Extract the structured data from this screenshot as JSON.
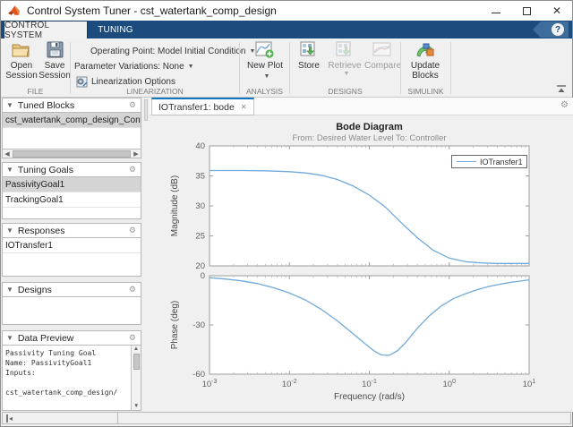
{
  "window": {
    "title": "Control System Tuner - cst_watertank_comp_design",
    "minimize": "–",
    "maximize": "",
    "close": "✕"
  },
  "ribbon_tabs": {
    "control_system": "CONTROL SYSTEM",
    "tuning": "TUNING",
    "help": "?"
  },
  "ribbon": {
    "file": {
      "label": "FILE",
      "open": "Open Session",
      "save": "Save Session"
    },
    "linearization": {
      "label": "LINEARIZATION",
      "operating_point_label": "Operating Point:",
      "operating_point_value": "Model Initial Condition",
      "parameter_variations_label": "Parameter Variations:",
      "parameter_variations_value": "None",
      "options": "Linearization Options"
    },
    "analysis": {
      "label": "ANALYSIS",
      "new_plot": "New Plot"
    },
    "designs": {
      "label": "DESIGNS",
      "store": "Store",
      "retrieve": "Retrieve",
      "compare": "Compare"
    },
    "simulink": {
      "label": "SIMULINK",
      "update_blocks": "Update Blocks"
    }
  },
  "sidebar": {
    "panels": [
      {
        "title": "Tuned Blocks",
        "items": [
          "cst_watertank_comp_design_Controller"
        ],
        "selected": 0
      },
      {
        "title": "Tuning Goals",
        "items": [
          "PassivityGoal1",
          "TrackingGoal1"
        ],
        "selected": 0
      },
      {
        "title": "Responses",
        "items": [
          "IOTransfer1"
        ],
        "selected": -1
      },
      {
        "title": "Designs",
        "items": [],
        "selected": -1
      },
      {
        "title": "Data Preview",
        "items": [],
        "selected": -1
      }
    ],
    "data_preview_lines": [
      "Passivity Tuning Goal",
      "Name: PassivityGoal1",
      "Inputs:",
      "",
      "cst_watertank_comp_design/"
    ]
  },
  "document": {
    "tab": "IOTransfer1: bode",
    "close": "✕"
  },
  "chart_data": {
    "type": "line",
    "title": "Bode Diagram",
    "subtitle": "From: Desired  Water Level  To: Controller",
    "xlabel": "Frequency  (rad/s)",
    "xscale": "log",
    "xlim_exponents": [
      -3,
      1
    ],
    "x_tick_exponents": [
      -3,
      -2,
      -1,
      0,
      1
    ],
    "grid": false,
    "legend": [
      "IOTransfer1"
    ],
    "legend_position": "northeast",
    "line_color": "#72a9dc",
    "subplots": [
      {
        "name": "magnitude",
        "ylabel": "Magnitude (dB)",
        "ylim": [
          20,
          40
        ],
        "yticks": [
          40,
          35,
          30,
          25,
          20
        ],
        "series": [
          {
            "name": "IOTransfer1",
            "points": [
              [
                -3,
                35.9
              ],
              [
                -2.6,
                35.9
              ],
              [
                -2.3,
                35.85
              ],
              [
                -2.0,
                35.7
              ],
              [
                -1.8,
                35.5
              ],
              [
                -1.6,
                35.1
              ],
              [
                -1.4,
                34.4
              ],
              [
                -1.2,
                33.3
              ],
              [
                -1.0,
                31.8
              ],
              [
                -0.8,
                29.8
              ],
              [
                -0.6,
                27.2
              ],
              [
                -0.4,
                24.7
              ],
              [
                -0.2,
                22.6
              ],
              [
                0,
                21.3
              ],
              [
                0.2,
                20.7
              ],
              [
                0.4,
                20.5
              ],
              [
                0.6,
                20.4
              ],
              [
                0.8,
                20.4
              ],
              [
                1,
                20.4
              ]
            ]
          }
        ]
      },
      {
        "name": "phase",
        "ylabel": "Phase (deg)",
        "ylim": [
          -60,
          0
        ],
        "yticks": [
          0,
          -30,
          -60
        ],
        "series": [
          {
            "name": "IOTransfer1",
            "points": [
              [
                -3,
                -1.2
              ],
              [
                -2.8,
                -2
              ],
              [
                -2.6,
                -3.1
              ],
              [
                -2.4,
                -4.8
              ],
              [
                -2.2,
                -7.3
              ],
              [
                -2,
                -10.5
              ],
              [
                -1.8,
                -14.8
              ],
              [
                -1.6,
                -20.5
              ],
              [
                -1.4,
                -27.5
              ],
              [
                -1.2,
                -35.5
              ],
              [
                -1.05,
                -41.5
              ],
              [
                -0.95,
                -45.5
              ],
              [
                -0.85,
                -48.3
              ],
              [
                -0.75,
                -48.5
              ],
              [
                -0.65,
                -45.8
              ],
              [
                -0.55,
                -41
              ],
              [
                -0.4,
                -32
              ],
              [
                -0.25,
                -24.5
              ],
              [
                -0.1,
                -18.5
              ],
              [
                0.05,
                -14
              ],
              [
                0.2,
                -11
              ],
              [
                0.35,
                -8.5
              ],
              [
                0.5,
                -6.5
              ],
              [
                0.65,
                -5
              ],
              [
                0.8,
                -3.8
              ],
              [
                1,
                -2.5
              ]
            ]
          }
        ]
      }
    ]
  },
  "status": {
    "collapse": "◂"
  },
  "colors": {
    "accent_navy": "#1b4c7d",
    "tab_active_border": "#1377bf",
    "curve": "#72a9dc",
    "selection_gray": "#d4d4d4"
  }
}
